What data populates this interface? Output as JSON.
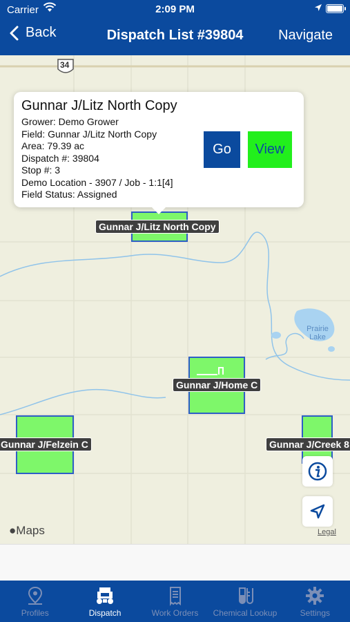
{
  "status_bar": {
    "carrier": "Carrier",
    "time": "2:09 PM"
  },
  "nav": {
    "back_label": "Back",
    "title": "Dispatch List #39804",
    "navigate_label": "Navigate"
  },
  "map": {
    "road_shield": "34",
    "lake_label": "Prairie Lake",
    "maps_attribution": "Maps",
    "legal_label": "Legal",
    "fields": [
      {
        "name": "Gunnar J/Litz North Copy"
      },
      {
        "name": "Gunnar J/Home C"
      },
      {
        "name": "Gunnar J/Felzein C"
      },
      {
        "name": "Gunnar J/Creek 8"
      }
    ],
    "field_color": "#7ef76a",
    "field_border_color": "#2e5ec6"
  },
  "popup": {
    "title": "Gunnar J/Litz North Copy",
    "grower": "Grower: Demo Grower",
    "field": "Field: Gunnar J/Litz North Copy",
    "area": "Area: 79.39 ac",
    "dispatch": "Dispatch #: 39804",
    "stop": "Stop #: 3",
    "location": "Demo Location - 3907 / Job - 1:1[4]",
    "status": "Field Status: Assigned",
    "go_label": "Go",
    "view_label": "View"
  },
  "tabs": [
    {
      "label": "Profiles",
      "icon": "map-pin-icon",
      "active": false
    },
    {
      "label": "Dispatch",
      "icon": "tractor-icon",
      "active": true
    },
    {
      "label": "Work Orders",
      "icon": "document-icon",
      "active": false
    },
    {
      "label": "Chemical Lookup",
      "icon": "flask-icon",
      "active": false
    },
    {
      "label": "Settings",
      "icon": "gear-icon",
      "active": false
    }
  ],
  "colors": {
    "brand_blue": "#0b4a9e",
    "view_green": "#22ef1c",
    "map_bg": "#efefdf"
  }
}
